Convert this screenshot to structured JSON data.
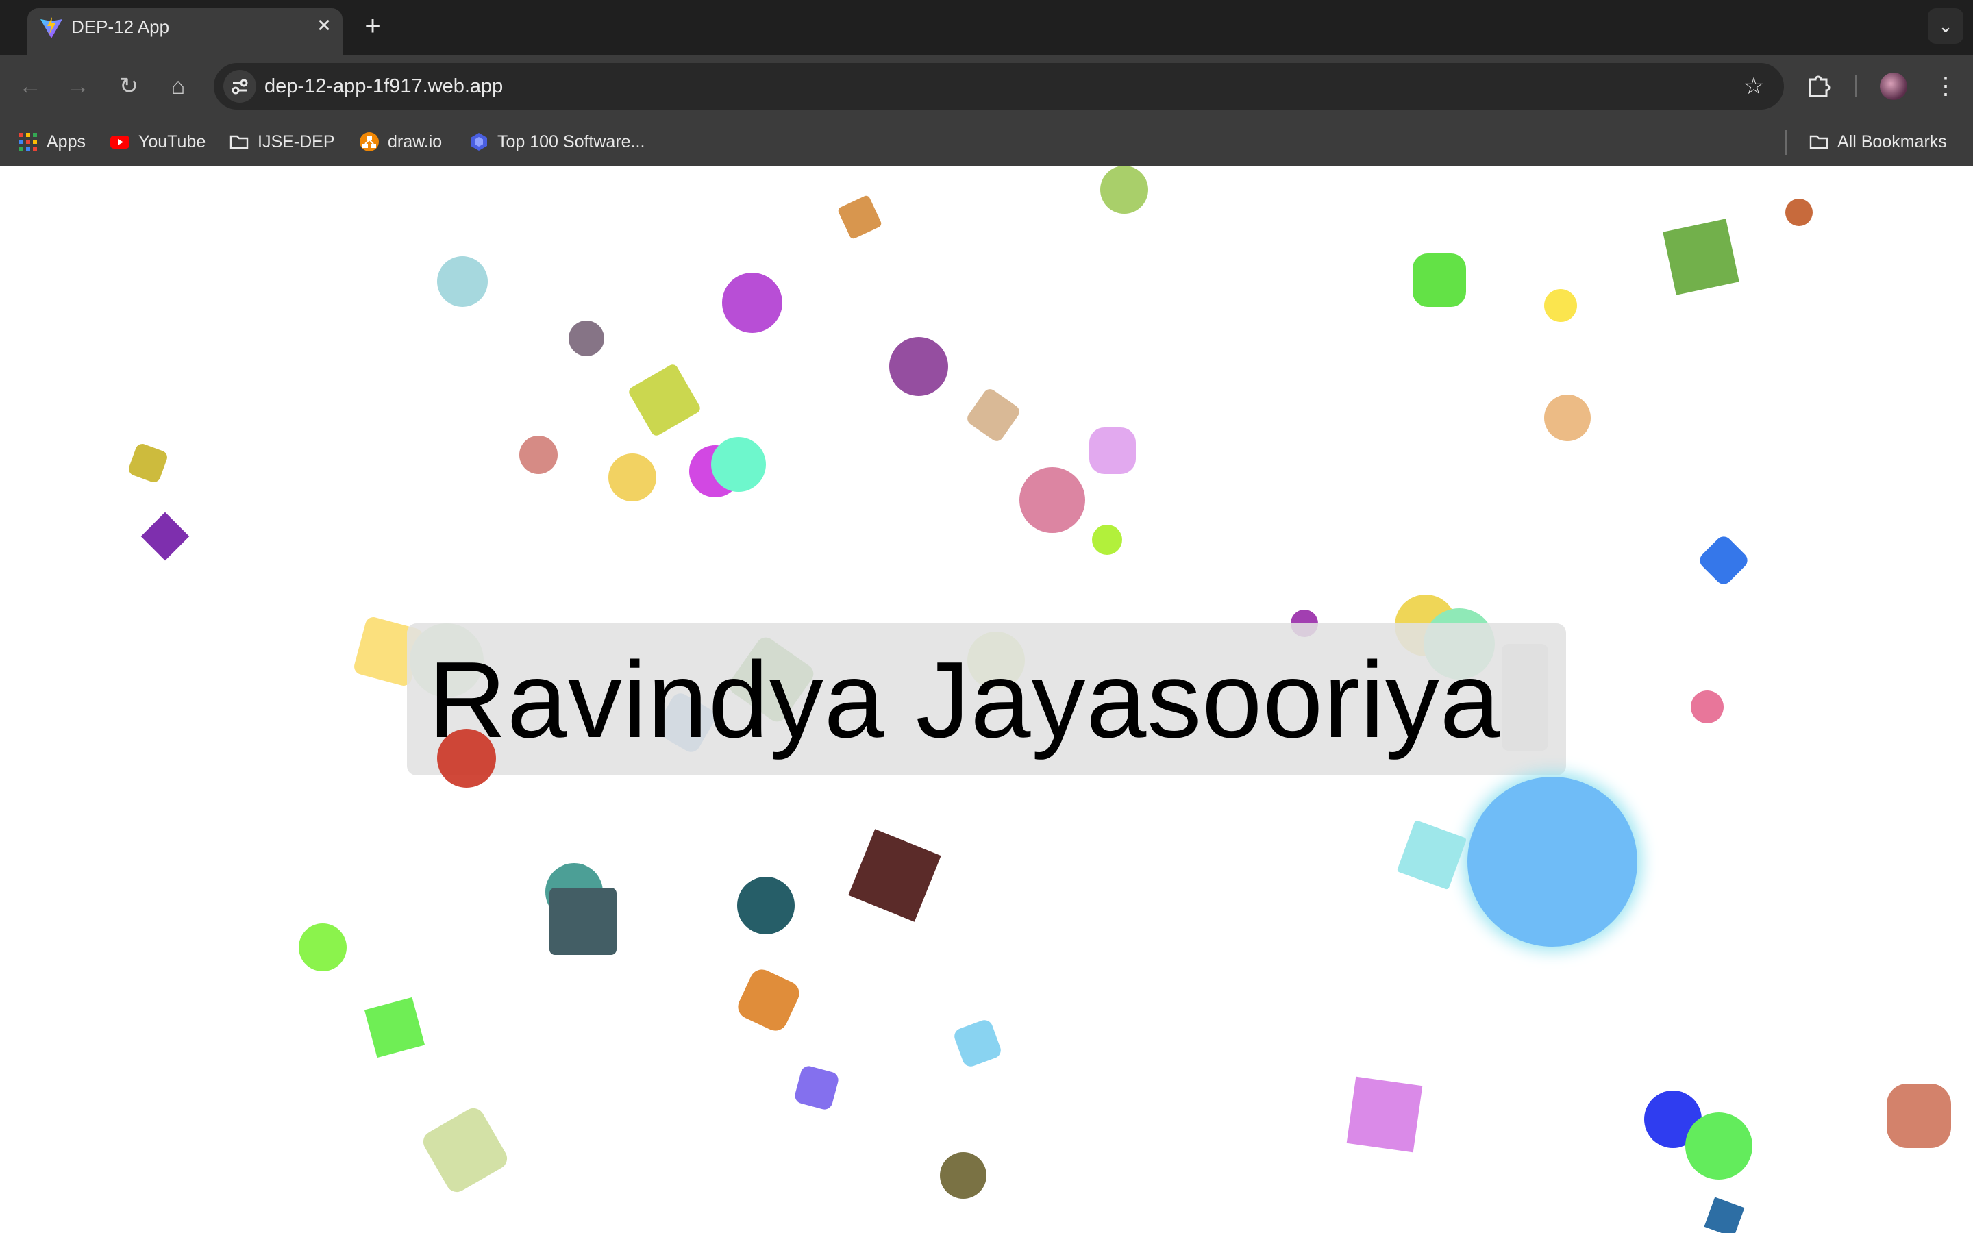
{
  "browser": {
    "tab": {
      "title": "DEP-12 App",
      "favicon": "vite-logo-icon",
      "close_glyph": "✕"
    },
    "new_tab_glyph": "+",
    "tab_search_glyph": "⌄",
    "nav": {
      "back": "←",
      "forward": "→",
      "reload": "↻",
      "home": "⌂"
    },
    "url": "dep-12-app-1f917.web.app",
    "bookmarks": [
      {
        "label": "Apps",
        "icon": "apps-grid-icon"
      },
      {
        "label": "YouTube",
        "icon": "youtube-icon"
      },
      {
        "label": "IJSE-DEP",
        "icon": "folder-icon"
      },
      {
        "label": "draw.io",
        "icon": "drawio-icon"
      },
      {
        "label": "Top 100 Software...",
        "icon": "hexagon-icon"
      }
    ],
    "all_bookmarks": "All Bookmarks"
  },
  "main": {
    "name": "Ravindya Jayasooriya",
    "colors": {
      "highlight": "#6fbcf7",
      "card": "#e1e1e1"
    }
  }
}
